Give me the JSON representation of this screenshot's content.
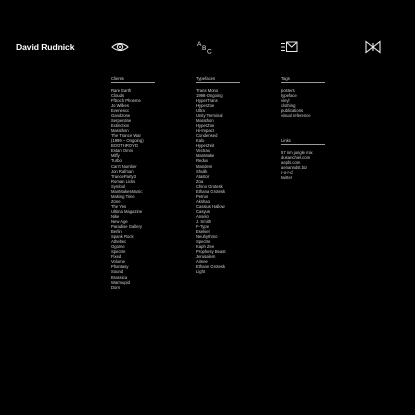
{
  "header": {
    "brand": "David Rudnick",
    "icons": [
      "eye-icon",
      "abc-icon",
      "mail-icon",
      "butterfly-icon"
    ]
  },
  "clients": {
    "heading": "Clients",
    "items": [
      "Rare Earth",
      "Clouds",
      "Fftroch Phoeme",
      "Jo Wilkes",
      "Evenescc",
      "Gandzone",
      "Serpentine",
      "Extinction",
      "Marathon",
      "The Trance War",
      "(1999 – Ongoing)",
      "BOOTHROYD",
      "Estan Omni",
      "Miffy",
      "Turbo",
      "Can't Number",
      "Jon Rafman",
      "TranceParty3",
      "Roman Licks",
      "Symbol",
      "ManMakesMusic",
      "Making Time",
      "Zone",
      "The Yes",
      "Ultima Magazine",
      "Nike",
      "New Age",
      "Paradise Gallery",
      "Berlin",
      "Spank Rock",
      "Atheltec",
      "Ogome",
      "Spectre",
      "Fixed",
      "Volume",
      "Phantasy",
      "Sound",
      "Brassica",
      "Warmupid",
      "Dorn"
    ]
  },
  "typefaces": {
    "heading": "Typefaces",
    "items": [
      "Trans Mono",
      "1998-Ongoing",
      "HyperTrans",
      "HyperZoe",
      "Ultra",
      "Unity Terminal",
      "Marathon",
      "HyperZoe",
      "Hi-Impact",
      "Condensed",
      "Kalo",
      "HyperZeit",
      "Vectrax",
      "ManMake",
      "Redux",
      "Mandem",
      "Shulik",
      "Atastor",
      "Zoa",
      "Chino Grotesk",
      "Ethana Grotesk",
      "Petrus",
      "Akshao",
      "Cassius Hallow",
      "Casyus",
      "Anselo",
      "J. Smith",
      "F-Type",
      "Esekiel",
      "Neuhythmo",
      "Spectre",
      "Kaph Zee",
      "Prophesy Beast",
      "Jerusalem",
      "Aimee",
      "Ethane Grotesk",
      "Light"
    ]
  },
  "tags": {
    "heading": "Tags",
    "items": [
      "posters",
      "typeface",
      "vinyl",
      "clothing",
      "publications",
      "visual reference"
    ]
  },
  "links": {
    "heading": "Links",
    "items": [
      "57 nm jungle mix",
      "dusanchiel.com",
      "aephi.com",
      "aenanndst.biz",
      "r-o-r-d",
      "twitter"
    ]
  },
  "colors": {
    "background": "#000000",
    "text": "#cfcfcf",
    "brand": "#ffffff"
  }
}
